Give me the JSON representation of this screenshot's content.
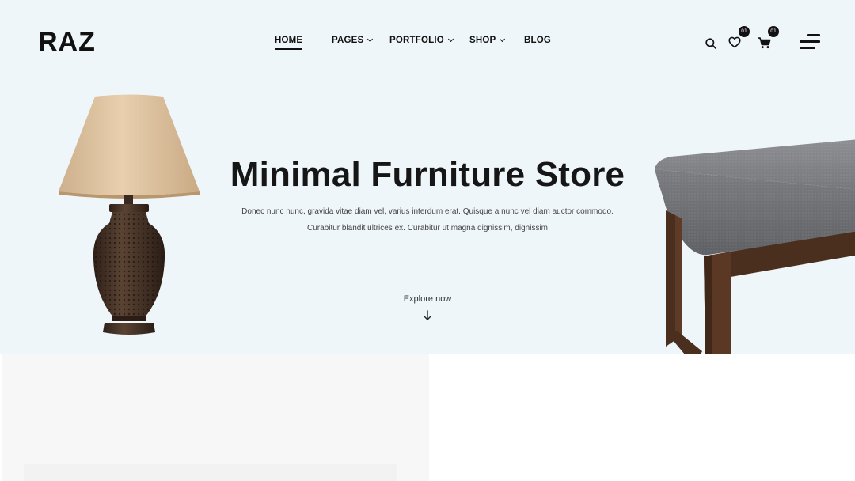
{
  "header": {
    "logo": "RAZ",
    "nav": [
      {
        "label": "HOME",
        "active": true,
        "dropdown": false
      },
      {
        "label": "PAGES",
        "active": false,
        "dropdown": true
      },
      {
        "label": "PORTFOLIO",
        "active": false,
        "dropdown": true
      },
      {
        "label": "SHOP",
        "active": false,
        "dropdown": true
      },
      {
        "label": "BLOG",
        "active": false,
        "dropdown": false
      }
    ],
    "icons": {
      "search": "search-icon",
      "wishlist": "heart-icon",
      "cart": "cart-icon",
      "menu": "hamburger-menu-icon"
    },
    "wishlist_count": "01",
    "cart_count": "01"
  },
  "hero": {
    "title": "Minimal Furniture Store",
    "description_line1": "Donec nunc nunc, gravida vitae diam vel, varius interdum erat. Quisque a nunc vel diam auctor commodo.",
    "description_line2": "Curabitur blandit ultrices ex. Curabitur ut magna dignissim, dignissim",
    "cta_label": "Explore now",
    "cta_icon": "arrow-down-icon",
    "images": [
      "table-lamp-image",
      "upholstered-bench-image"
    ]
  },
  "colors": {
    "hero_background": "#eff6fa",
    "text": "#111111",
    "badge": "#111111",
    "panel_background": "#f7f7f7"
  }
}
